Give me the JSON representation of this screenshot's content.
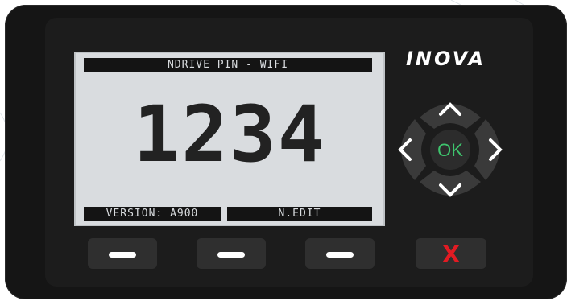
{
  "brand": {
    "logo_text": "INOVA"
  },
  "screen": {
    "title": "NDRIVE PIN - WIFI",
    "pin": "1234",
    "version": "VERSION: A900",
    "edit_label": "N.EDIT"
  },
  "keypad": {
    "ok_label": "OK",
    "cancel_label": "X"
  },
  "colors": {
    "ok_green": "#3ec46d",
    "cancel_red": "#e21b23",
    "lcd_background": "#d9dcdf",
    "device_body": "#151515"
  }
}
